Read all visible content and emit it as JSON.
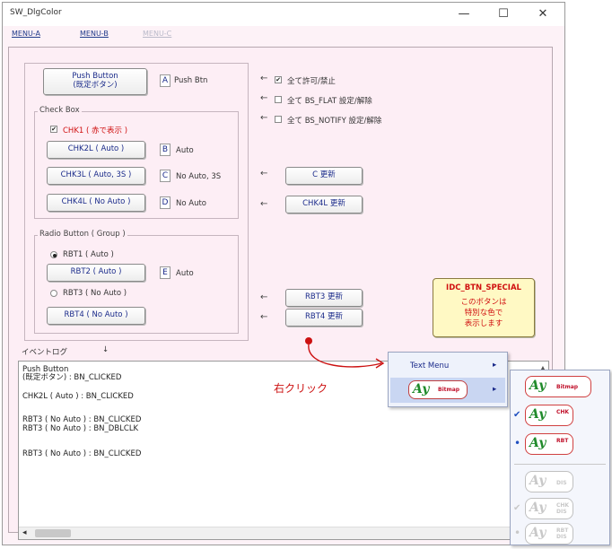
{
  "window": {
    "title": "SW_DlgColor",
    "minimize_glyph": "—",
    "maximize_glyph": "☐",
    "close_glyph": "✕"
  },
  "menubar": {
    "items": [
      "MENU-A",
      "MENU-B",
      "MENU-C"
    ]
  },
  "push": {
    "label_line1": "Push Button",
    "label_line2": "(既定ボタン)",
    "hotkey": "A",
    "desc": "Push Btn"
  },
  "checkbox_group": {
    "title": "Check Box",
    "chk1_label": "CHK1 ( 赤で表示 )",
    "chk1_checked": "✔",
    "chk2_label": "CHK2L ( Auto )",
    "chk2_hotkey": "B",
    "chk2_desc": "Auto",
    "chk3_label": "CHK3L ( Auto, 3S )",
    "chk3_hotkey": "C",
    "chk3_desc": "No Auto, 3S",
    "chk4_label": "CHK4L ( No Auto )",
    "chk4_hotkey": "D",
    "chk4_desc": "No Auto"
  },
  "radio_group": {
    "title": "Radio Button ( Group )",
    "rbt1_label": "RBT1 ( Auto )",
    "rbt2_label": "RBT2 ( Auto )",
    "rbt2_hotkey": "E",
    "rbt2_desc": "Auto",
    "rbt3_label": "RBT3 ( No Auto )",
    "rbt4_label": "RBT4 ( No Auto )"
  },
  "right": {
    "arrow": "←",
    "all_enable_label": "全て許可/禁止",
    "all_enable_check": "✔",
    "all_flat_label": "全て BS_FLAT 設定/解除",
    "all_notify_label": "全て BS_NOTIFY 設定/解除",
    "c_update": "C 更新",
    "chk4l_update": "CHK4L 更新",
    "rbt3_update": "RBT3 更新",
    "rbt4_update": "RBT4 更新"
  },
  "special": {
    "title": "IDC_BTN_SPECIAL",
    "line1": "このボタンは",
    "line2": "特別な色で",
    "line3": "表示します"
  },
  "eventlog": {
    "label": "イベントログ",
    "down_arrow": "↓",
    "lines": [
      "Push Button",
      "(既定ボタン) : BN_CLICKED",
      "CHK2L ( Auto ) : BN_CLICKED",
      "RBT3 ( No Auto ) : BN_CLICKED",
      "RBT3 ( No Auto ) : BN_DBLCLK",
      "RBT3 ( No Auto ) : BN_CLICKED"
    ],
    "scroll_left": "◂",
    "scroll_up": "▲"
  },
  "annotation": {
    "right_click": "右クリック"
  },
  "context_menu": {
    "items": [
      {
        "label": "Text Menu",
        "arrow": "▸"
      },
      {
        "label": "Bitmap",
        "arrow": "▸",
        "icon": "Ay"
      }
    ]
  },
  "submenu": {
    "icon": "Ay",
    "items": [
      {
        "label": "Bitmap",
        "state": ""
      },
      {
        "label": "CHK",
        "state": "✔"
      },
      {
        "label": "RBT",
        "state": "•"
      },
      {
        "label": "DIS",
        "state": ""
      },
      {
        "label": "CHK DIS",
        "state": "✔"
      },
      {
        "label": "RBT DIS",
        "state": "•"
      }
    ]
  },
  "colors": {
    "accent_red": "#d01010",
    "menu_blue": "#1a2a8a",
    "dialog_bg": "#fdeef5",
    "special_bg": "#fff9c4",
    "annotation_red": "#cc1111"
  }
}
